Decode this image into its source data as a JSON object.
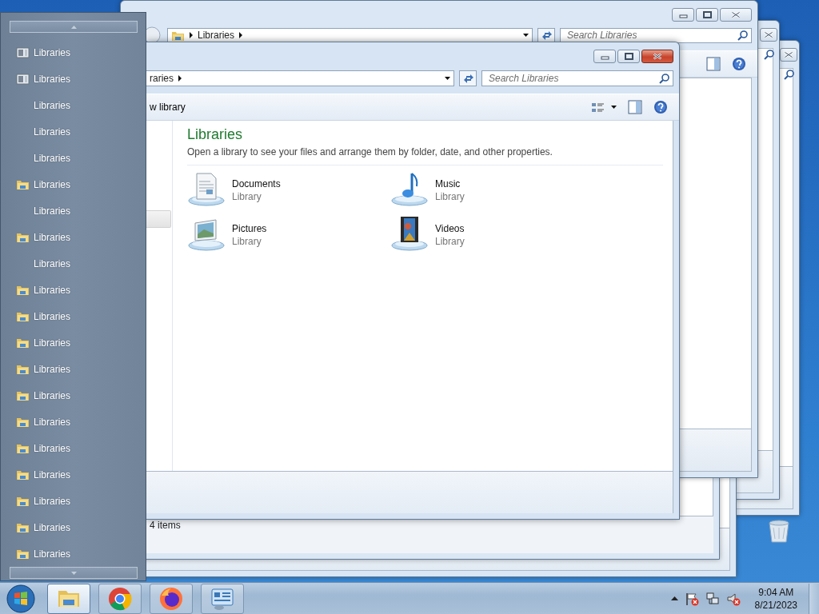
{
  "background_windows": [
    {
      "kind": "frame"
    },
    {
      "kind": "frame"
    },
    {
      "kind": "plain"
    },
    {
      "kind": "status",
      "status": "4 items"
    },
    {
      "kind": "explorer",
      "address": "Libraries",
      "search": {
        "placeholder": "Search Libraries"
      }
    }
  ],
  "explorer": {
    "address": "raries",
    "search": {
      "placeholder": "Search Libraries"
    },
    "toolbar_label": "w library",
    "heading": "Libraries",
    "description": "Open a library to see your files and arrange them by folder, date, and other properties.",
    "libraries": [
      {
        "kind": "documents",
        "name": "Documents",
        "type": "Library"
      },
      {
        "kind": "music",
        "name": "Music",
        "type": "Library"
      },
      {
        "kind": "pictures",
        "name": "Pictures",
        "type": "Library"
      },
      {
        "kind": "videos",
        "name": "Videos",
        "type": "Library"
      }
    ]
  },
  "jump_list": {
    "items": [
      {
        "kind": "library",
        "label": "Libraries"
      },
      {
        "kind": "library",
        "label": "Libraries"
      },
      {
        "kind": "plain",
        "label": "Libraries"
      },
      {
        "kind": "plain",
        "label": "Libraries"
      },
      {
        "kind": "plain",
        "label": "Libraries"
      },
      {
        "kind": "folder",
        "label": "Libraries"
      },
      {
        "kind": "plain",
        "label": "Libraries"
      },
      {
        "kind": "folder",
        "label": "Libraries"
      },
      {
        "kind": "plain",
        "label": "Libraries"
      },
      {
        "kind": "folder",
        "label": "Libraries"
      },
      {
        "kind": "folder",
        "label": "Libraries"
      },
      {
        "kind": "folder",
        "label": "Libraries"
      },
      {
        "kind": "folder",
        "label": "Libraries"
      },
      {
        "kind": "folder",
        "label": "Libraries"
      },
      {
        "kind": "folder",
        "label": "Libraries"
      },
      {
        "kind": "folder",
        "label": "Libraries"
      },
      {
        "kind": "folder",
        "label": "Libraries"
      },
      {
        "kind": "folder",
        "label": "Libraries"
      },
      {
        "kind": "folder",
        "label": "Libraries"
      },
      {
        "kind": "folder",
        "label": "Libraries"
      }
    ]
  },
  "taskbar": {
    "buttons": [
      {
        "kind": "explorer",
        "selected": true
      },
      {
        "kind": "chrome",
        "selected": false
      },
      {
        "kind": "firefox",
        "selected": false
      },
      {
        "kind": "control-panel",
        "selected": false
      }
    ],
    "clock": {
      "time": "9:04 AM",
      "date": "8/21/2023"
    }
  }
}
